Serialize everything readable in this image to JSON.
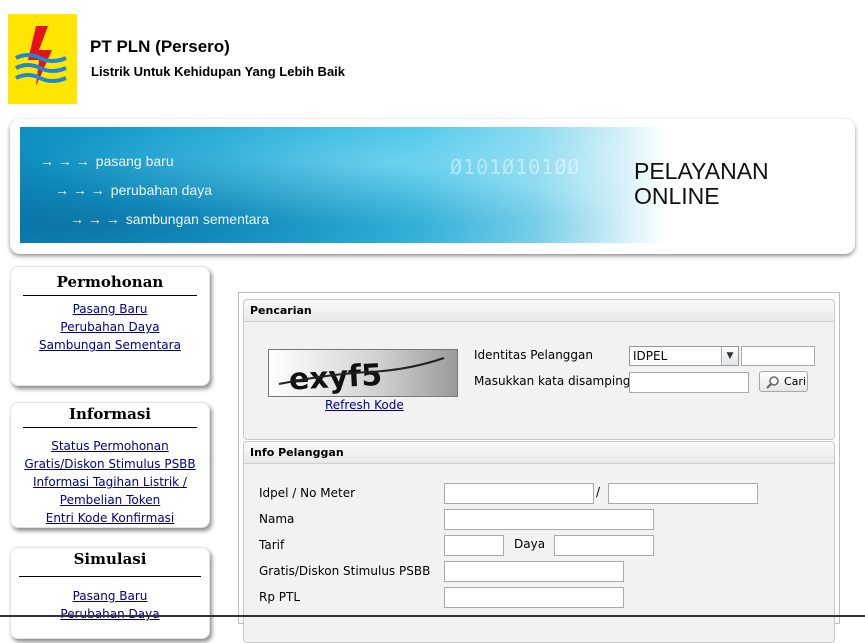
{
  "header": {
    "company": "PT PLN (Persero)",
    "tagline": "Listrik Untuk Kehidupan Yang Lebih Baik",
    "logo_icon": "pln-lightning-logo-icon"
  },
  "banner": {
    "lines": [
      "pasang baru",
      "perubahan daya",
      "sambungan sementara"
    ],
    "arrows": "→ → →",
    "binary_text": "Ø101Ø101ØØ",
    "title_line1": "PELAYANAN",
    "title_line2": "ONLINE"
  },
  "sidebar": {
    "permohonan": {
      "title": "Permohonan",
      "links": [
        "Pasang Baru",
        "Perubahan Daya",
        "Sambungan Sementara"
      ]
    },
    "informasi": {
      "title": "Informasi",
      "links": [
        "Status Permohonan",
        "Gratis/Diskon Stimulus PSBB",
        "Informasi Tagihan Listrik /",
        "Pembelian Token",
        "Entri Kode Konfirmasi"
      ]
    },
    "simulasi": {
      "title": "Simulasi",
      "links": [
        "Pasang Baru",
        "Perubahan Daya"
      ]
    }
  },
  "pencarian": {
    "legend": "Pencarian",
    "captcha_text": "exyf5",
    "refresh_label": "Refresh Kode",
    "identitas_label": "Identitas Pelanggan",
    "select_value": "IDPEL",
    "kata_label": "Masukkan kata disamping:",
    "search_button": "Cari",
    "idpel_value": "",
    "kata_value": ""
  },
  "info": {
    "legend": "Info Pelanggan",
    "labels": {
      "idpel": "Idpel / No Meter",
      "nama": "Nama",
      "tarif": "Tarif",
      "daya": "Daya",
      "gratis": "Gratis/Diskon Stimulus PSBB",
      "rp_ptl": "Rp PTL"
    },
    "separator": "/"
  },
  "colors": {
    "logo_bg": "#ffe600",
    "logo_red": "#e3121b",
    "logo_blue": "#1e88d6",
    "link": "#00008b",
    "banner_blue": "#1aa7d6"
  }
}
